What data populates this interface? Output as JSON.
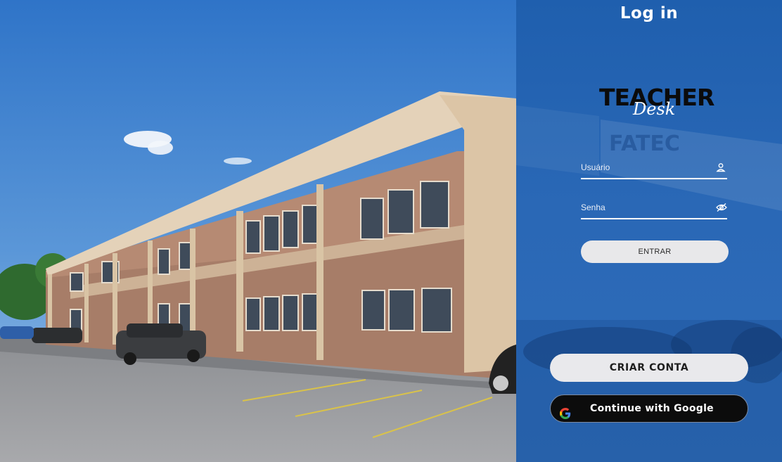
{
  "header": {
    "title": "Log in"
  },
  "logo": {
    "main": "TEACHER",
    "script": "Desk"
  },
  "form": {
    "username_placeholder": "Usuário",
    "password_placeholder": "Senha",
    "submit_label": "ENTRAR"
  },
  "actions": {
    "create_account_label": "CRIAR CONTA",
    "google_label": "Continue with Google"
  },
  "background_sign": {
    "text": "FATEC"
  },
  "icons": {
    "user": "user-icon",
    "password_visibility": "eye-off-icon",
    "google": "google-icon"
  },
  "colors": {
    "panel": "#2a68b6",
    "button_light": "#e9e9ec",
    "button_dark": "#0c0c0c"
  }
}
